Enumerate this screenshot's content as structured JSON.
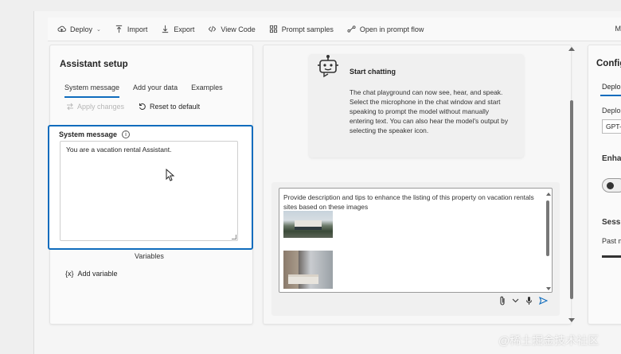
{
  "toolbar": {
    "deploy": "Deploy",
    "import": "Import",
    "export": "Export",
    "view_code": "View Code",
    "prompt_samples": "Prompt samples",
    "open_prompt_flow": "Open in prompt flow",
    "end_text": "M"
  },
  "assistant_setup": {
    "title": "Assistant setup",
    "tabs": [
      "System message",
      "Add your data",
      "Examples"
    ],
    "apply_changes": "Apply changes",
    "reset_default": "Reset to default",
    "system_message_label": "System message",
    "system_message_value": "You are a vacation rental Assistant.",
    "variables_label": "Variables",
    "add_variable": "Add variable",
    "add_variable_prefix": "{x}"
  },
  "chat": {
    "start_title": "Start chatting",
    "start_text": "The chat playground can now see, hear, and speak. Select the microphone in the chat window and start speaking to prompt the model without manually entering text. You can also hear the model's output by selecting the speaker icon.",
    "input_text": "Provide description and tips to enhance the listing of this property on vacation rentals sites based on these images"
  },
  "config": {
    "title": "Configu",
    "tab": "Deplo",
    "deploy_label": "Deplo",
    "deploy_value": "GPT-",
    "enhance_label": "Enha",
    "session_label": "Sessio",
    "past_label": "Past m"
  },
  "watermark": "@稀土掘金技术社区",
  "colors": {
    "accent": "#0f6cbd"
  }
}
